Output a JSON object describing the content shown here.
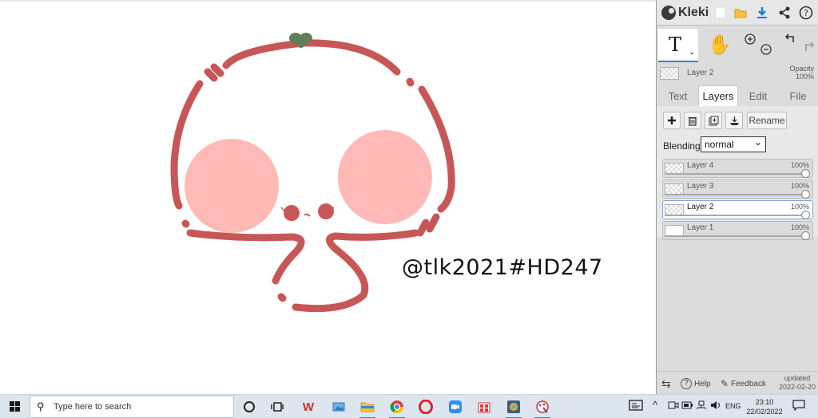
{
  "canvas": {
    "watermark": "@tlk2021#HD247",
    "colors": {
      "outline": "#c75757",
      "cheeks": "#ffb9b6",
      "leaf": "#5f7f5a",
      "background": "#ffffff"
    }
  },
  "app": {
    "name": "Kleki",
    "top_icons": [
      "new-image-icon",
      "open-folder-icon",
      "download-icon",
      "share-icon",
      "help-icon"
    ]
  },
  "tools": {
    "active": "text-tool",
    "items": [
      "text-tool",
      "hand-tool",
      "zoom-in-icon",
      "zoom-out-icon",
      "undo-icon",
      "redo-icon"
    ]
  },
  "current_layer": {
    "name": "Layer 2",
    "opacity_label": "Opacity",
    "opacity_value": "100%"
  },
  "tabs": [
    {
      "label": "Text",
      "active": false
    },
    {
      "label": "Layers",
      "active": true
    },
    {
      "label": "Edit",
      "active": false
    },
    {
      "label": "File",
      "active": false
    }
  ],
  "layers_panel": {
    "buttons": [
      "add-layer-button",
      "delete-layer-button",
      "duplicate-layer-button",
      "merge-down-button"
    ],
    "rename_label": "Rename",
    "blending_label": "Blending",
    "blending_value": "normal",
    "layers": [
      {
        "name": "Layer 4",
        "opacity": "100%",
        "active": false
      },
      {
        "name": "Layer 3",
        "opacity": "100%",
        "active": false
      },
      {
        "name": "Layer 2",
        "opacity": "100%",
        "active": true
      },
      {
        "name": "Layer 1",
        "opacity": "100%",
        "active": false
      }
    ]
  },
  "footer": {
    "help_label": "Help",
    "feedback_label": "Feedback",
    "updated_label": "updated",
    "updated_date": "2022-02-20"
  },
  "taskbar": {
    "search_placeholder": "Type here to search",
    "apps": [
      "cortana-icon",
      "task-view-icon",
      "wps-office-icon",
      "photos-icon",
      "file-explorer-icon",
      "chrome-icon",
      "opera-icon",
      "zoom-icon",
      "store-icon",
      "photo-viewer-icon",
      "paint-icon"
    ],
    "language": "ENG",
    "time": "23:10",
    "date": "22/02/2022"
  }
}
